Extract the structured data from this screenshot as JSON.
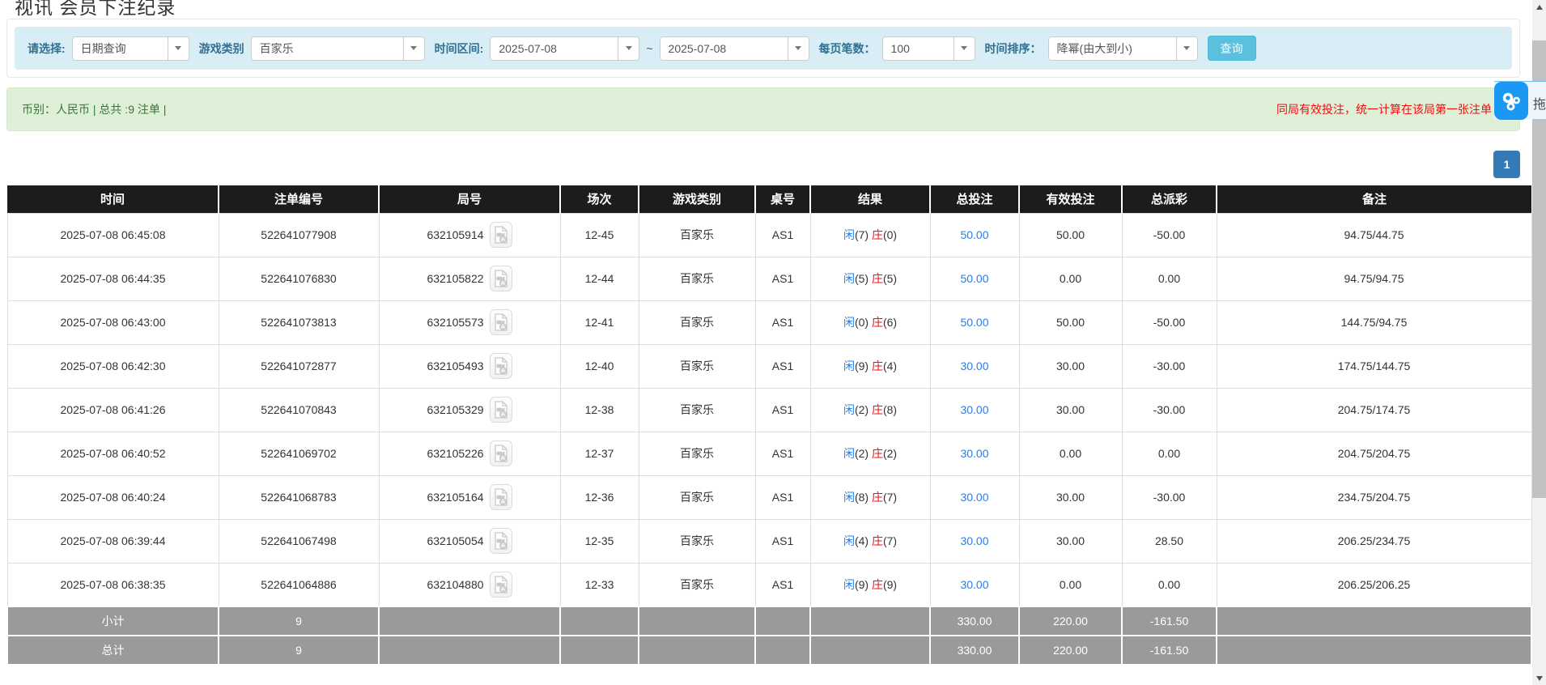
{
  "page_title": "视讯 会员下注纪录",
  "filters": {
    "select_label": "请选择:",
    "select_value": "日期查询",
    "game_category_label": "游戏类别",
    "game_category_value": "百家乐",
    "time_range_label": "时间区间:",
    "date_from": "2025-07-08",
    "range_separator": "~",
    "date_to": "2025-07-08",
    "page_size_label": "每页笔数：",
    "page_size_value": "100",
    "time_sort_label": "时间排序：",
    "time_sort_value": "降幂(由大到小)",
    "query_button": "查询"
  },
  "summary_bar": {
    "left_text": "币别：人民币 | 总共 :9 注单 |",
    "notice_text": "同局有效投注，统一计算在该局第一张注单",
    "drag_label": "拖"
  },
  "pagination": {
    "current_page": "1"
  },
  "table": {
    "headers": [
      "时间",
      "注单编号",
      "局号",
      "场次",
      "游戏类别",
      "桌号",
      "结果",
      "总投注",
      "有效投注",
      "总派彩",
      "备注"
    ],
    "result_player_label": "闲",
    "result_banker_label": "庄",
    "rows": [
      {
        "time": "2025-07-08 06:45:08",
        "bet_id": "522641077908",
        "round_id": "632105914",
        "session": "12-45",
        "game": "百家乐",
        "table_no": "AS1",
        "player": "7",
        "banker": "0",
        "total_bet": "50.00",
        "valid_bet": "50.00",
        "payout": "-50.00",
        "remark": "94.75/44.75"
      },
      {
        "time": "2025-07-08 06:44:35",
        "bet_id": "522641076830",
        "round_id": "632105822",
        "session": "12-44",
        "game": "百家乐",
        "table_no": "AS1",
        "player": "5",
        "banker": "5",
        "total_bet": "50.00",
        "valid_bet": "0.00",
        "payout": "0.00",
        "remark": "94.75/94.75"
      },
      {
        "time": "2025-07-08 06:43:00",
        "bet_id": "522641073813",
        "round_id": "632105573",
        "session": "12-41",
        "game": "百家乐",
        "table_no": "AS1",
        "player": "0",
        "banker": "6",
        "total_bet": "50.00",
        "valid_bet": "50.00",
        "payout": "-50.00",
        "remark": "144.75/94.75"
      },
      {
        "time": "2025-07-08 06:42:30",
        "bet_id": "522641072877",
        "round_id": "632105493",
        "session": "12-40",
        "game": "百家乐",
        "table_no": "AS1",
        "player": "9",
        "banker": "4",
        "total_bet": "30.00",
        "valid_bet": "30.00",
        "payout": "-30.00",
        "remark": "174.75/144.75"
      },
      {
        "time": "2025-07-08 06:41:26",
        "bet_id": "522641070843",
        "round_id": "632105329",
        "session": "12-38",
        "game": "百家乐",
        "table_no": "AS1",
        "player": "2",
        "banker": "8",
        "total_bet": "30.00",
        "valid_bet": "30.00",
        "payout": "-30.00",
        "remark": "204.75/174.75"
      },
      {
        "time": "2025-07-08 06:40:52",
        "bet_id": "522641069702",
        "round_id": "632105226",
        "session": "12-37",
        "game": "百家乐",
        "table_no": "AS1",
        "player": "2",
        "banker": "2",
        "total_bet": "30.00",
        "valid_bet": "0.00",
        "payout": "0.00",
        "remark": "204.75/204.75"
      },
      {
        "time": "2025-07-08 06:40:24",
        "bet_id": "522641068783",
        "round_id": "632105164",
        "session": "12-36",
        "game": "百家乐",
        "table_no": "AS1",
        "player": "8",
        "banker": "7",
        "total_bet": "30.00",
        "valid_bet": "30.00",
        "payout": "-30.00",
        "remark": "234.75/204.75"
      },
      {
        "time": "2025-07-08 06:39:44",
        "bet_id": "522641067498",
        "round_id": "632105054",
        "session": "12-35",
        "game": "百家乐",
        "table_no": "AS1",
        "player": "4",
        "banker": "7",
        "total_bet": "30.00",
        "valid_bet": "30.00",
        "payout": "28.50",
        "remark": "206.25/234.75"
      },
      {
        "time": "2025-07-08 06:38:35",
        "bet_id": "522641064886",
        "round_id": "632104880",
        "session": "12-33",
        "game": "百家乐",
        "table_no": "AS1",
        "player": "9",
        "banker": "9",
        "total_bet": "30.00",
        "valid_bet": "0.00",
        "payout": "0.00",
        "remark": "206.25/206.25"
      }
    ],
    "subtotal": {
      "label": "小计",
      "count": "9",
      "total_bet": "330.00",
      "valid_bet": "220.00",
      "payout": "-161.50",
      "remark": ""
    },
    "total": {
      "label": "总计",
      "count": "9",
      "total_bet": "330.00",
      "valid_bet": "220.00",
      "payout": "-161.50",
      "remark": ""
    }
  },
  "colors": {
    "header_bg": "#1c1c1c",
    "summary_gray": "#9a9a9a",
    "link_blue": "#2b7ce0",
    "negative_red": "#ee0f0f",
    "accent_blue": "#1a98f4",
    "panel_blue": "#d9edf7",
    "alert_green": "#dff0d8",
    "pagination_blue": "#337ab7",
    "button_cyan": "#5bc0de"
  }
}
